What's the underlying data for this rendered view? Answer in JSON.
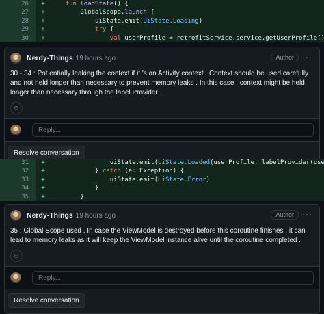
{
  "diff1": [
    {
      "num": "26",
      "sign": "+",
      "code": [
        {
          "t": "    "
        },
        {
          "t": "fun ",
          "c": "kw"
        },
        {
          "t": "loadState",
          "c": "fn"
        },
        {
          "t": "() {"
        }
      ]
    },
    {
      "num": "27",
      "sign": "+",
      "code": [
        {
          "t": "        GlobalScope."
        },
        {
          "t": "launch",
          "c": "fn"
        },
        {
          "t": " {"
        }
      ]
    },
    {
      "num": "28",
      "sign": "+",
      "code": [
        {
          "t": "            uiState.emit("
        },
        {
          "t": "UiState.Loading",
          "c": "ty"
        },
        {
          "t": ")"
        }
      ]
    },
    {
      "num": "29",
      "sign": "+",
      "code": [
        {
          "t": "            "
        },
        {
          "t": "try",
          "c": "kw"
        },
        {
          "t": " {"
        }
      ]
    },
    {
      "num": "30",
      "sign": "+",
      "code": [
        {
          "t": "                "
        },
        {
          "t": "val",
          "c": "kw"
        },
        {
          "t": " userProfile = retrofitService.service.getUserProfile().userProfile"
        }
      ]
    }
  ],
  "diff2": [
    {
      "num": "31",
      "sign": "+",
      "code": [
        {
          "t": "                uiState.emit("
        },
        {
          "t": "UiState.Loaded",
          "c": "ty"
        },
        {
          "t": "(userProfile, labelProvider(userProfile)))"
        }
      ]
    },
    {
      "num": "32",
      "sign": "+",
      "code": [
        {
          "t": "            } "
        },
        {
          "t": "catch",
          "c": "kw"
        },
        {
          "t": " (e: Exception) {"
        }
      ]
    },
    {
      "num": "33",
      "sign": "+",
      "code": [
        {
          "t": "                uiState.emit("
        },
        {
          "t": "UiState.Error",
          "c": "ty"
        },
        {
          "t": ")"
        }
      ]
    },
    {
      "num": "34",
      "sign": "+",
      "code": [
        {
          "t": "            }"
        }
      ]
    },
    {
      "num": "35",
      "sign": "+",
      "code": [
        {
          "t": "        }"
        }
      ]
    }
  ],
  "comment1": {
    "author": "Nerdy-Things",
    "time": "19 hours ago",
    "badge": "Author",
    "kebab": "···",
    "body": "30 - 34 : Pot entially leaking the context if it 's an Activity context . Context should be used carefully and not held longer than necessary to prevent memory leaks . In this case , context might be held longer than necessary through the label Provider .",
    "emoji": "☺",
    "reply_placeholder": "Reply...",
    "resolve_label": "Resolve conversation"
  },
  "comment2": {
    "author": "Nerdy-Things",
    "time": "19 hours ago",
    "badge": "Author",
    "kebab": "···",
    "body": "35 : Global Scope used . In case the ViewModel is destroyed before this coroutine finishes , it can lead to memory leaks as it will keep the ViewModel instance alive until the coroutine completed .",
    "emoji": "☺",
    "reply_placeholder": "Reply...",
    "resolve_label": "Resolve conversation"
  }
}
